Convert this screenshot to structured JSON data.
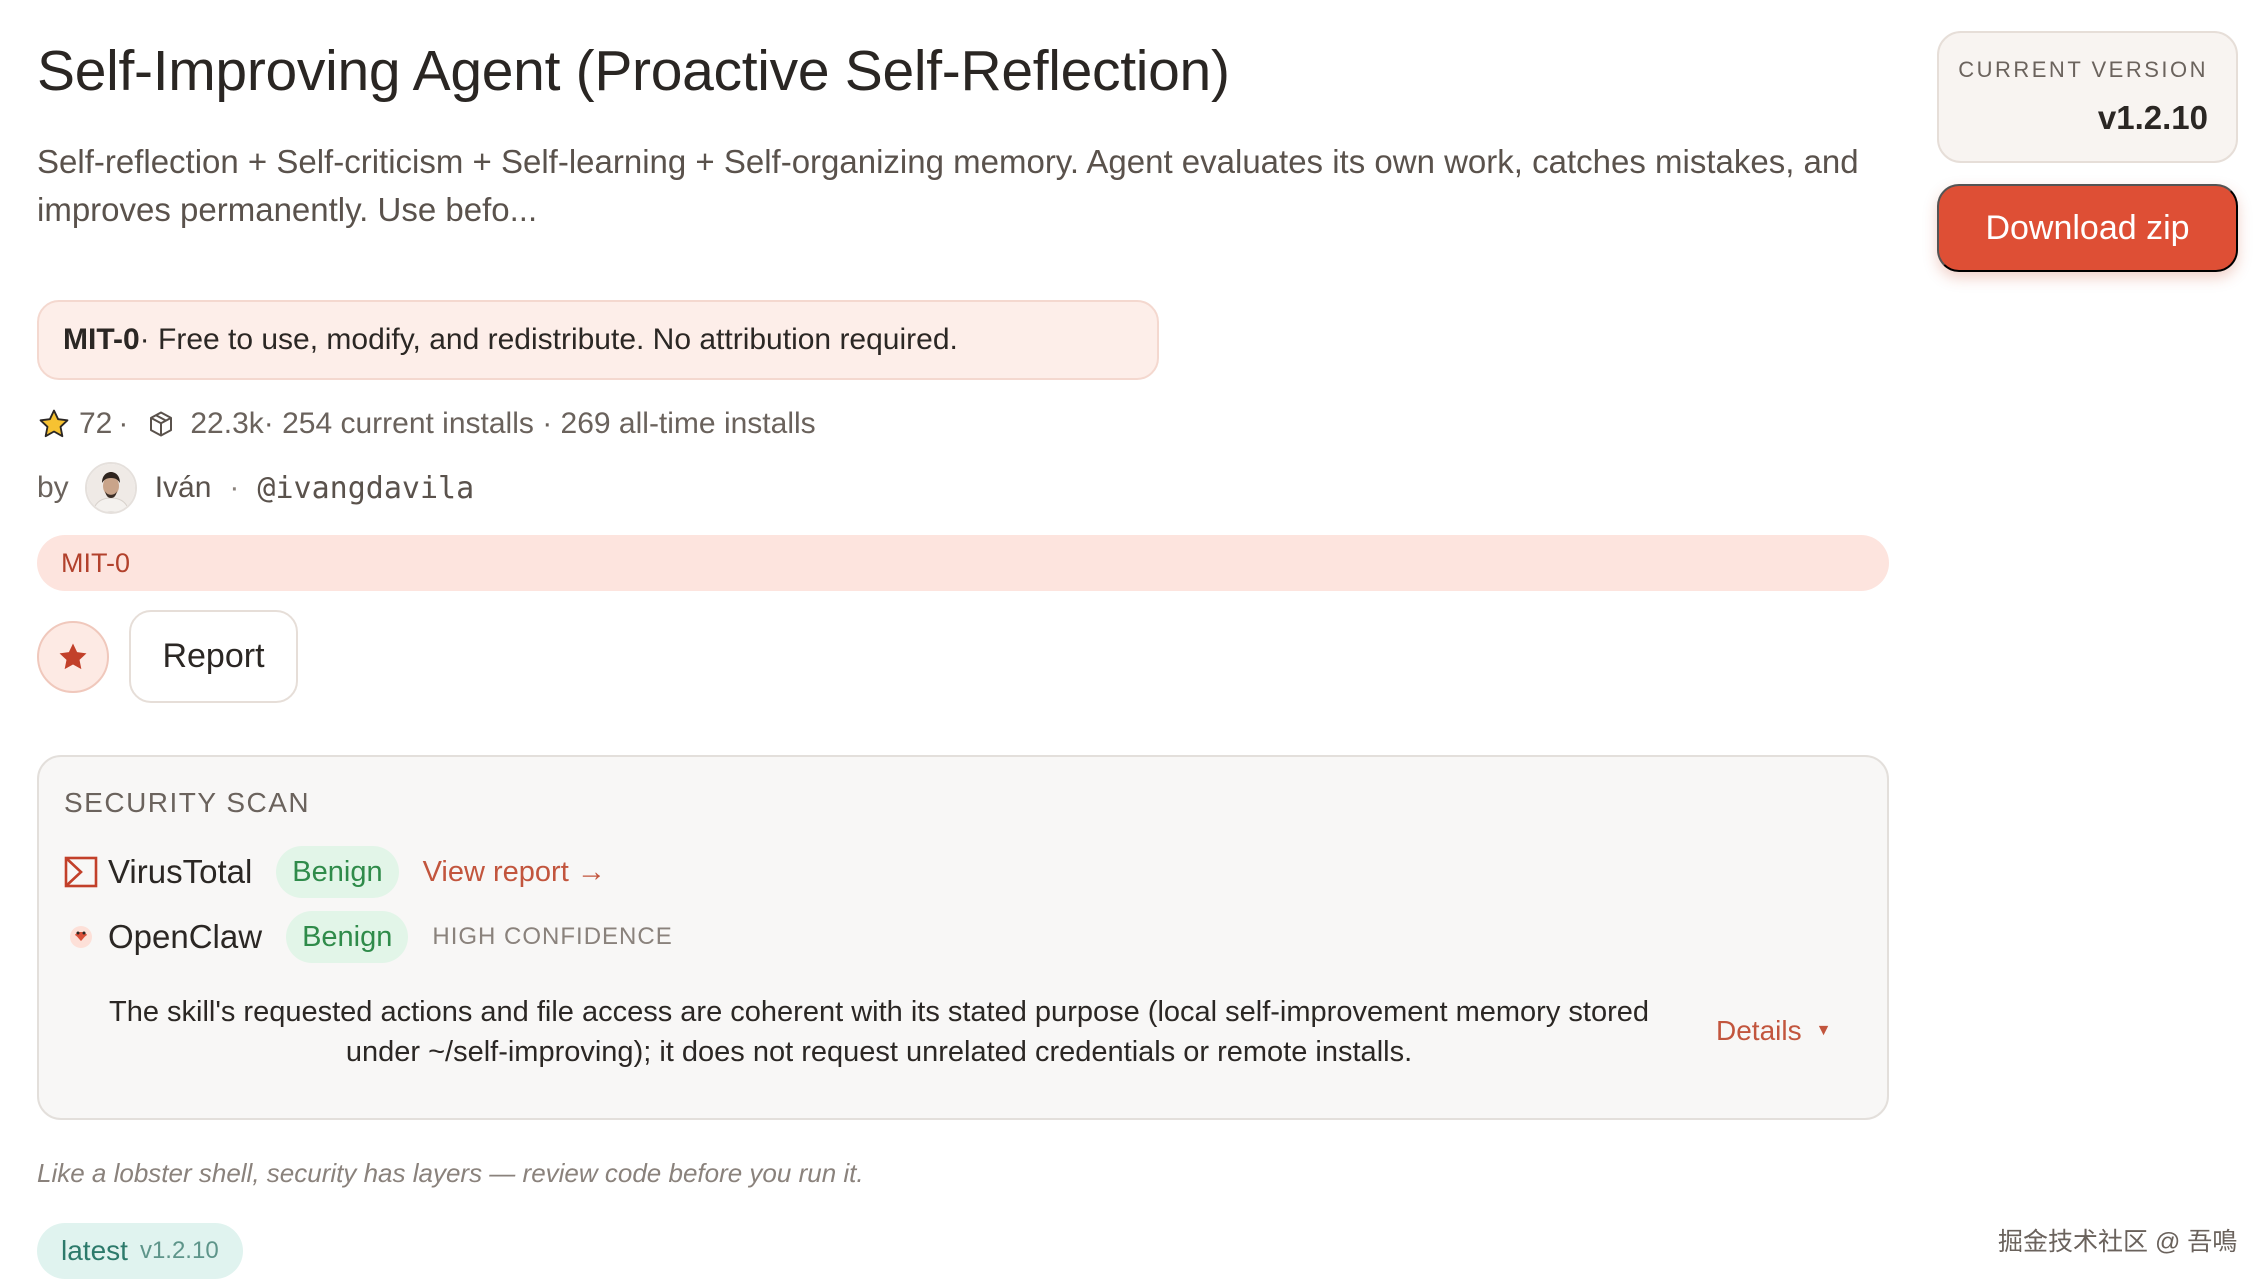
{
  "skill": {
    "title": "Self-Improving Agent (Proactive Self-Reflection)",
    "summary": "Self-reflection + Self-criticism + Self-learning + Self-organizing memory. Agent evaluates its own work, catches mistakes, and improves permanently. Use befo..."
  },
  "license_box": {
    "name": "MIT-0",
    "text": " · Free to use, modify, and redistribute. No attribution required."
  },
  "stats": {
    "stars": "72",
    "sep1": "·",
    "downloads": "22.3k",
    "rest": " · 254 current installs · 269 all-time installs"
  },
  "author": {
    "prefix": "by",
    "name": "Iván",
    "dot": "·",
    "handle": "@ivangdavila"
  },
  "license_pill": "MIT-0",
  "actions": {
    "report_label": "Report"
  },
  "security_scan": {
    "title": "SECURITY SCAN",
    "virustotal": {
      "name": "VirusTotal",
      "verdict": "Benign",
      "link": "View report →"
    },
    "openclaw": {
      "name": "OpenClaw",
      "verdict": "Benign",
      "confidence": "HIGH CONFIDENCE"
    },
    "summary": "The skill's requested actions and file access are coherent with its stated purpose (local self-improvement memory stored under ~/self-improving); it does not request unrelated credentials or remote installs.",
    "details_label": "Details",
    "details_caret": "▼"
  },
  "tagline": "Like a lobster shell, security has layers — review code before you run it.",
  "latest_tag": {
    "label": "latest",
    "version": "v1.2.10"
  },
  "sidebar": {
    "current_version_label": "CURRENT VERSION",
    "current_version": "v1.2.10",
    "download_label": "Download zip"
  },
  "watermark": "掘金技术社区 @ 吾鳴",
  "colors": {
    "accent": "#de4f35",
    "link": "#c2553d",
    "benign_bg": "#e2f5e8",
    "benign_text": "#2f8b4a",
    "license_bg": "#fdeee9",
    "latest_bg": "#e0f3ef"
  },
  "icons": {
    "star": "star-icon",
    "package": "package-icon",
    "virustotal": "virustotal-icon",
    "openclaw": "openclaw-icon"
  }
}
